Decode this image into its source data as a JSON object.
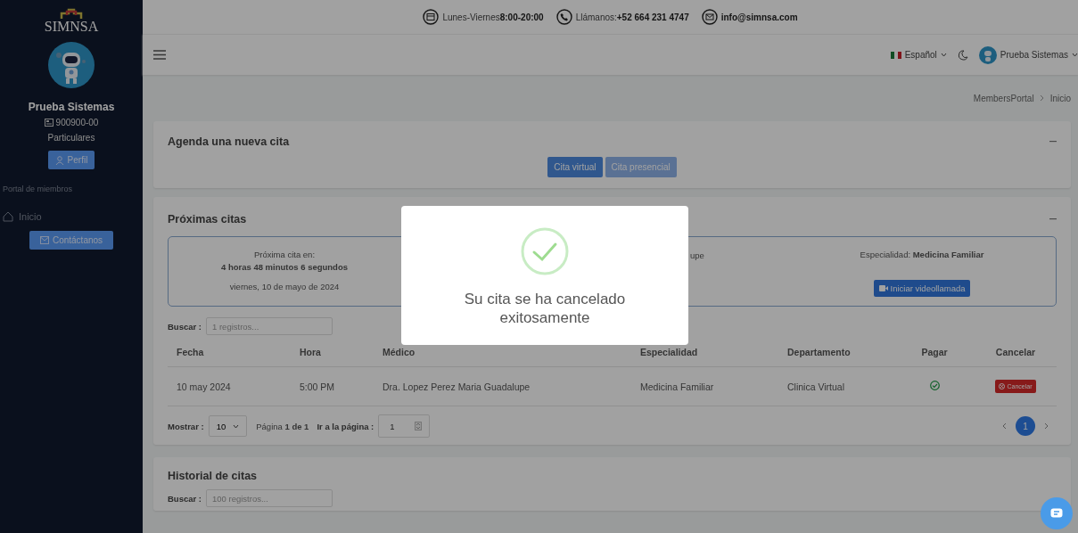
{
  "contact_bar": [
    {
      "kind": "calendar",
      "label": "Lunes-Viernes",
      "value": "8:00-20:00"
    },
    {
      "kind": "phone",
      "label": "Llámanos:",
      "value": "+52 664 231 4747"
    },
    {
      "kind": "mail",
      "value": "info@simnsa.com"
    }
  ],
  "sidebar": {
    "logo_text": "SIMNSA",
    "user_name": "Prueba Sistemas",
    "member_id": "900900-00",
    "plan": "Particulares",
    "profile_button": "Perfil",
    "section_title": "Portal de miembros",
    "nav": [
      {
        "label": "Inicio"
      }
    ],
    "contact_button": "Contáctanos"
  },
  "navbar": {
    "language": "Español",
    "user": "Prueba Sistemas"
  },
  "breadcrumb": [
    "MembersPortal",
    "Inicio"
  ],
  "new_appointment": {
    "title": "Agenda una nueva cita",
    "buttons": [
      {
        "label": "Cita virtual",
        "selected": true
      },
      {
        "label": "Cita presencial",
        "selected": false
      }
    ]
  },
  "upcoming": {
    "title": "Próximas citas",
    "next_card": {
      "countdown_label": "Próxima cita en:",
      "countdown": "4 horas 48 minutos 6 segundos",
      "date": "viernes, 10 de mayo de 2024",
      "doctor_partial": "upe",
      "specialty": "Especialidad: **Medicina Familiar**",
      "video_button": "Iniciar videollamada"
    },
    "search": {
      "label": "Buscar :",
      "placeholder": "1 registros..."
    },
    "columns": [
      "Fecha",
      "Hora",
      "Médico",
      "Especialidad",
      "Departamento",
      "Pagar",
      "Cancelar"
    ],
    "rows": [
      {
        "date": "10 may 2024",
        "time": "5:00 PM",
        "doctor": "Dra. Lopez Perez Maria Guadalupe",
        "specialty": "Medicina Familiar",
        "department": "Clinica Virtual",
        "paid": true,
        "cancel": "Cancelar"
      }
    ],
    "footer": {
      "show_label": "Mostrar :",
      "page_size": "10",
      "page_text": "Página **1 de 1**",
      "goto_label": "Ir a la página :",
      "goto_value": "1"
    },
    "pages": [
      {
        "label": "1",
        "selected": true
      }
    ]
  },
  "history": {
    "title": "Historial de citas",
    "search": {
      "label": "Buscar :",
      "placeholder": "100 registros..."
    }
  },
  "modal": {
    "kind": "success",
    "message": "Su cita se ha cancelado exitosamente"
  }
}
